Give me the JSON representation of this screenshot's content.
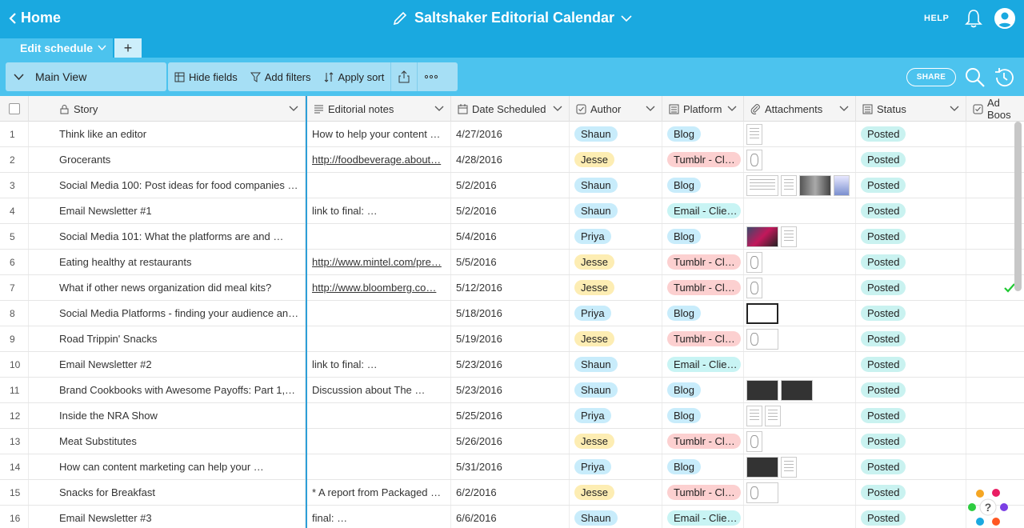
{
  "header": {
    "home_label": "Home",
    "title": "Saltshaker Editorial Calendar",
    "help_label": "HELP"
  },
  "tabs": {
    "active_label": "Edit schedule",
    "add_label": "+"
  },
  "toolbar": {
    "view_label": "Main View",
    "hide_fields": "Hide fields",
    "add_filters": "Add filters",
    "apply_sort": "Apply sort",
    "share_label": "SHARE"
  },
  "columns": {
    "story": "Story",
    "notes": "Editorial notes",
    "date": "Date Scheduled",
    "author": "Author",
    "platform": "Platform",
    "attachments": "Attachments",
    "status": "Status",
    "adboost": "Ad Boos"
  },
  "colors": {
    "header_blue": "#1aa9e0",
    "toolbar_blue": "#4cc3ee",
    "author_shaun": "#c8ecfb",
    "author_jesse": "#fdedb3",
    "author_priya": "#c8ecfb",
    "platform_blog": "#c8ecfb",
    "platform_tumblr": "#fcd0d0",
    "platform_email": "#c8f4f4",
    "status_posted": "#c9f2f0"
  },
  "rows": [
    {
      "num": "1",
      "story": "Think like an editor",
      "notes": "How to help your content …",
      "notes_link": false,
      "date": "4/27/2016",
      "author": "Shaun",
      "platform": "Blog",
      "attachments": [
        "doc"
      ],
      "status": "Posted",
      "adboost": false
    },
    {
      "num": "2",
      "story": "Grocerants",
      "notes": "http://foodbeverage.about…",
      "notes_link": true,
      "date": "4/28/2016",
      "author": "Jesse",
      "platform": "Tumblr - Cl…",
      "attachments": [
        "sketch"
      ],
      "status": "Posted",
      "adboost": false
    },
    {
      "num": "3",
      "story": "Social Media 100: Post ideas for food companies …",
      "notes": "",
      "notes_link": false,
      "date": "5/2/2016",
      "author": "Shaun",
      "platform": "Blog",
      "attachments": [
        "wide",
        "doc",
        "img2",
        "img3"
      ],
      "status": "Posted",
      "adboost": false
    },
    {
      "num": "4",
      "story": "Email Newsletter #1",
      "notes": "link to final: …",
      "notes_link": false,
      "date": "5/2/2016",
      "author": "Shaun",
      "platform": "Email - Clie…",
      "attachments": [],
      "status": "Posted",
      "adboost": false
    },
    {
      "num": "5",
      "story": "Social Media 101: What the platforms are and …",
      "notes": "",
      "notes_link": false,
      "date": "5/4/2016",
      "author": "Priya",
      "platform": "Blog",
      "attachments": [
        "img1wide",
        "doc"
      ],
      "status": "Posted",
      "adboost": false
    },
    {
      "num": "6",
      "story": "Eating healthy at restaurants",
      "notes": "http://www.mintel.com/pre…",
      "notes_link": true,
      "date": "5/5/2016",
      "author": "Jesse",
      "platform": "Tumblr - Cl…",
      "attachments": [
        "sketch"
      ],
      "status": "Posted",
      "adboost": false
    },
    {
      "num": "7",
      "story": "What if other news organization did meal kits?",
      "notes": "http://www.bloomberg.co…",
      "notes_link": true,
      "date": "5/12/2016",
      "author": "Jesse",
      "platform": "Tumblr - Cl…",
      "attachments": [
        "sketch"
      ],
      "status": "Posted",
      "adboost": true
    },
    {
      "num": "8",
      "story": "Social Media Platforms - finding your audience an…",
      "notes": "",
      "notes_link": false,
      "date": "5/18/2016",
      "author": "Priya",
      "platform": "Blog",
      "attachments": [
        "screenwide"
      ],
      "status": "Posted",
      "adboost": false
    },
    {
      "num": "9",
      "story": "Road Trippin' Snacks",
      "notes": "",
      "notes_link": false,
      "date": "5/19/2016",
      "author": "Jesse",
      "platform": "Tumblr - Cl…",
      "attachments": [
        "sketchwide"
      ],
      "status": "Posted",
      "adboost": false
    },
    {
      "num": "10",
      "story": "Email Newsletter #2",
      "notes": "link to final: …",
      "notes_link": false,
      "date": "5/23/2016",
      "author": "Shaun",
      "platform": "Email - Clie…",
      "attachments": [],
      "status": "Posted",
      "adboost": false
    },
    {
      "num": "11",
      "story": "Brand Cookbooks with Awesome Payoffs: Part 1,…",
      "notes": "Discussion about The …",
      "notes_link": false,
      "date": "5/23/2016",
      "author": "Shaun",
      "platform": "Blog",
      "attachments": [
        "darkwide",
        "darkwide"
      ],
      "status": "Posted",
      "adboost": false
    },
    {
      "num": "12",
      "story": "Inside the NRA Show",
      "notes": "",
      "notes_link": false,
      "date": "5/25/2016",
      "author": "Priya",
      "platform": "Blog",
      "attachments": [
        "doc",
        "doc"
      ],
      "status": "Posted",
      "adboost": false
    },
    {
      "num": "13",
      "story": "Meat Substitutes",
      "notes": "",
      "notes_link": false,
      "date": "5/26/2016",
      "author": "Jesse",
      "platform": "Tumblr - Cl…",
      "attachments": [
        "sketch"
      ],
      "status": "Posted",
      "adboost": false
    },
    {
      "num": "14",
      "story": "How can content marketing can help your …",
      "notes": "",
      "notes_link": false,
      "date": "5/31/2016",
      "author": "Priya",
      "platform": "Blog",
      "attachments": [
        "darkwide",
        "doc"
      ],
      "status": "Posted",
      "adboost": false
    },
    {
      "num": "15",
      "story": "Snacks for Breakfast",
      "notes": "* A report from Packaged …",
      "notes_link": false,
      "date": "6/2/2016",
      "author": "Jesse",
      "platform": "Tumblr - Cl…",
      "attachments": [
        "sketchwide"
      ],
      "status": "Posted",
      "adboost": false
    },
    {
      "num": "16",
      "story": "Email Newsletter #3",
      "notes": "final: …",
      "notes_link": false,
      "date": "6/6/2016",
      "author": "Shaun",
      "platform": "Email - Clie…",
      "attachments": [],
      "status": "Posted",
      "adboost": false
    }
  ]
}
